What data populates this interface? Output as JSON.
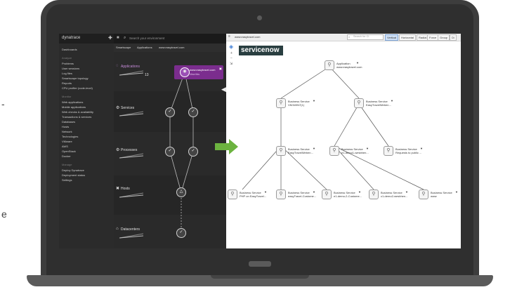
{
  "dynatrace": {
    "logo": "dynatrace",
    "search_placeholder": "Search your environment",
    "breadcrumb": [
      "Smartscape",
      "Applications",
      "www.easytravel.com"
    ],
    "nav_top": [
      "Dashboards"
    ],
    "nav_analyze_heading": "Analyze",
    "nav_analyze": [
      "Problems",
      "User sessions",
      "Log files",
      "Smartscape topology",
      "Reports",
      "CPU profiler (code-level)"
    ],
    "nav_monitor_heading": "Monitor",
    "nav_monitor": [
      "Web applications",
      "Mobile applications",
      "Web checks & availability",
      "Transactions & services",
      "Databases",
      "Hosts",
      "Network",
      "Technologies",
      "VMware",
      "AWS",
      "OpenStack",
      "Docker"
    ],
    "nav_manage_heading": "Manage",
    "nav_manage": [
      "Deploy Dynatrace",
      "Deployment status",
      "Settings"
    ],
    "layers": {
      "applications": {
        "label": "Applications",
        "count": "13"
      },
      "services": {
        "label": "Services"
      },
      "processes": {
        "label": "Processes"
      },
      "hosts": {
        "label": "Hosts"
      },
      "datacenters": {
        "label": "Datacenters"
      }
    },
    "selected_app": {
      "name": "www.easytravel.com",
      "sub": "View this"
    }
  },
  "servicenow": {
    "url": "www.easytravel.com",
    "search_placeholder": "Search for CI",
    "layout_tabs": [
      "Vertical",
      "Horizontal",
      "Radial",
      "Force",
      "Group",
      "Di"
    ],
    "active_tab": "Vertical",
    "logo": "servicenow",
    "root": {
      "type": "Application",
      "name": "www.easytravel.com"
    },
    "level1": [
      {
        "type": "Business Service",
        "name": "VM1WIN7(1)"
      },
      {
        "type": "Business Service",
        "name": "EasyTravelWeben..."
      }
    ],
    "level2": [
      {
        "type": "Business Service",
        "name": "EasyTravelWeben..."
      },
      {
        "type": "Business Service",
        "name": "e1-demo1-wesbhen..."
      },
      {
        "type": "Business Service",
        "name": "Requests to public ..."
      }
    ],
    "level3": [
      {
        "type": "Business Service",
        "name": "PHP on EasyTravel..."
      },
      {
        "type": "Business Service",
        "name": "easyTravel-Custome..."
      },
      {
        "type": "Business Service",
        "name": "e1-demo-2-Custome..."
      },
      {
        "type": "Business Service",
        "name": "c1-demo2-wesbhen..."
      },
      {
        "type": "Business Service",
        "name": "www"
      }
    ]
  },
  "colors": {
    "arrow": "#6cb33f",
    "accent_purple": "#7b2d8e",
    "servicenow_green": "#81b5a1"
  }
}
